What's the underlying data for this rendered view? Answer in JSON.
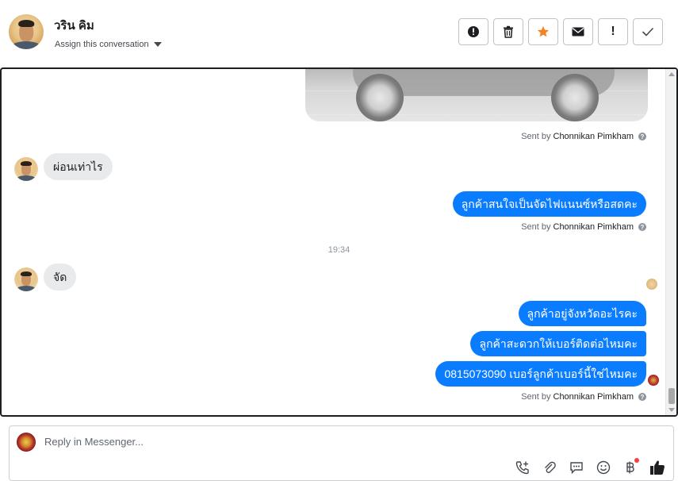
{
  "header": {
    "contact_name": "วริน คิม",
    "assign_label": "Assign this conversation",
    "actions": [
      {
        "icon": "alert-circle-icon",
        "label": "!"
      },
      {
        "icon": "trash-icon",
        "label": ""
      },
      {
        "icon": "star-icon",
        "label": ""
      },
      {
        "icon": "envelope-icon",
        "label": ""
      },
      {
        "icon": "exclamation-icon",
        "label": "!"
      },
      {
        "icon": "checkmark-icon",
        "label": ""
      }
    ]
  },
  "conversation": {
    "sent_by_prefix": "Sent by",
    "agent_name": "Chonnikan Pimkham",
    "help_mark": "?",
    "timestamp": "19:34",
    "messages": {
      "in_1": "ผ่อนเท่าไร",
      "out_1": "ลูกค้าสนใจเป็นจัดไฟแนนซ์หรือสดคะ",
      "in_2": "จัด",
      "out_2": "ลูกค้าอยู่จังหวัดอะไรคะ",
      "out_3": "ลูกค้าสะดวกให้เบอร์ติดต่อไหมคะ",
      "out_4": "0815073090 เบอร์ลูกค้าเบอร์นี้ใช่ไหมคะ"
    }
  },
  "composer": {
    "placeholder": "Reply in Messenger...",
    "tools": [
      "phone-plus-icon",
      "paperclip-icon",
      "chat-bubble-icon",
      "smiley-icon",
      "baht-icon",
      "thumbs-up-icon"
    ]
  },
  "colors": {
    "outgoing_bubble": "#0a7cff",
    "incoming_bubble": "#e9eaec",
    "star": "#f5821f",
    "notification_dot": "#fa3e3e"
  }
}
